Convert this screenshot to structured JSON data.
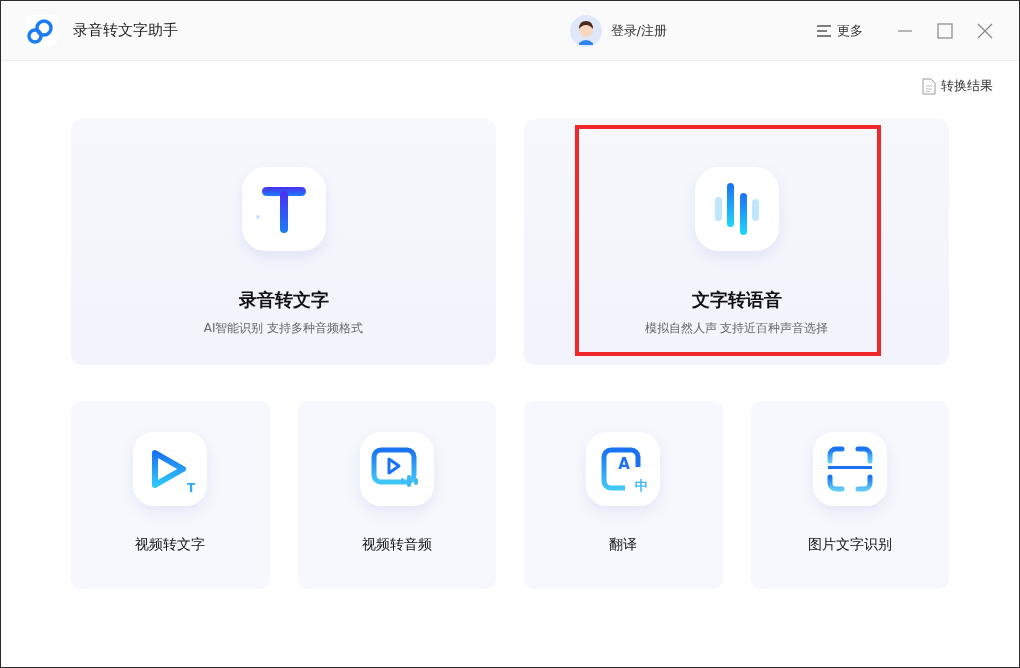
{
  "window": {
    "title": "录音转文字助手"
  },
  "account": {
    "label": "登录/注册"
  },
  "menu": {
    "label": "更多"
  },
  "results_link": {
    "label": "转换结果"
  },
  "main_features": [
    {
      "kind": "text",
      "title": "录音转文字",
      "subtitle": "AI智能识别 支持多种音频格式",
      "highlighted": false
    },
    {
      "kind": "wave",
      "title": "文字转语音",
      "subtitle": "模拟自然人声 支持近百种声音选择",
      "highlighted": true
    }
  ],
  "tools": [
    {
      "kind": "video-text",
      "title": "视频转文字",
      "glyphs": [
        "T"
      ]
    },
    {
      "kind": "video-audio",
      "title": "视频转音频"
    },
    {
      "kind": "translate",
      "title": "翻译",
      "glyphs": [
        "A",
        "中"
      ]
    },
    {
      "kind": "scan",
      "title": "图片文字识别"
    }
  ]
}
